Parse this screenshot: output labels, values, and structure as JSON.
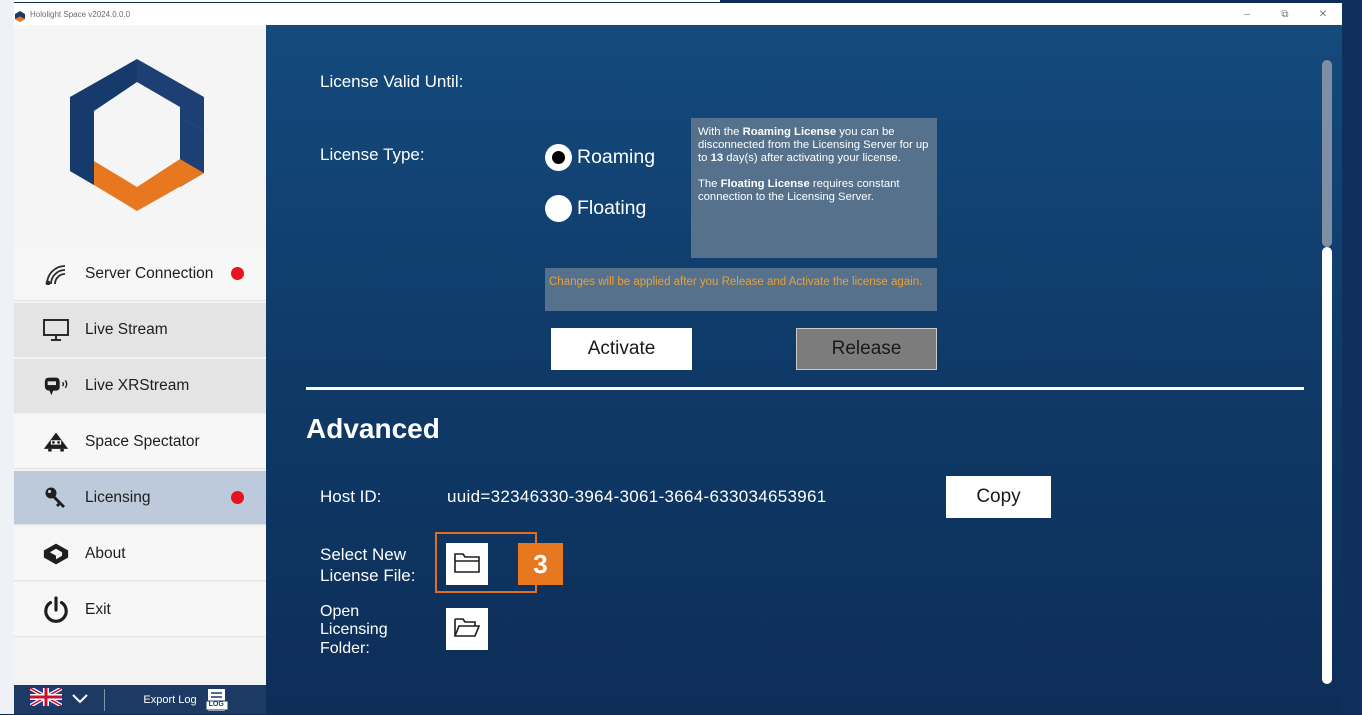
{
  "window": {
    "title": "Hololight Space v2024.0.0.0",
    "minimize": "–",
    "maximize": "⧉",
    "close": "✕"
  },
  "sidebar": {
    "items": [
      {
        "label": "Server Connection",
        "icon": "wifi-icon",
        "status_dot": true
      },
      {
        "label": "Live Stream",
        "icon": "monitor-icon",
        "status_dot": false
      },
      {
        "label": "Live XRStream",
        "icon": "xr-headset-icon",
        "status_dot": false
      },
      {
        "label": "Space Spectator",
        "icon": "spectator-icon",
        "status_dot": false
      },
      {
        "label": "Licensing",
        "icon": "key-icon",
        "status_dot": true,
        "selected": true
      },
      {
        "label": "About",
        "icon": "about-icon",
        "status_dot": false
      },
      {
        "label": "Exit",
        "icon": "power-icon",
        "status_dot": false
      }
    ],
    "bottom": {
      "language_icon": "uk-flag-icon",
      "export_label": "Export Log",
      "export_icon_text": "LOG"
    }
  },
  "license": {
    "valid_until_label": "License Valid Until:",
    "type_label": "License Type:",
    "options": [
      {
        "label": "Roaming",
        "selected": true
      },
      {
        "label": "Floating",
        "selected": false
      }
    ],
    "info": {
      "roaming_prefix": "With the ",
      "roaming_bold": "Roaming License",
      "roaming_mid": " you can be disconnected from the Licensing Server for up to ",
      "roaming_days": "13",
      "roaming_suffix": " day(s) after activating your license.",
      "floating_prefix": "The ",
      "floating_bold": "Floating License",
      "floating_suffix": " requires constant connection to the Licensing Server."
    },
    "warning": "Changes will be applied after you Release and Activate the license again.",
    "activate_label": "Activate",
    "release_label": "Release"
  },
  "advanced": {
    "title": "Advanced",
    "host_id_label": "Host ID:",
    "host_id_value": "uuid=32346330-3964-3061-3664-633034653961",
    "copy_label": "Copy",
    "select_file_label_line1": "Select New",
    "select_file_label_line2": "License File:",
    "open_folder_line1": "Open",
    "open_folder_line2": "Licensing",
    "open_folder_line3": "Folder:",
    "step_number": "3"
  },
  "colors": {
    "accent_orange": "#e8781f",
    "status_red": "#e8141b",
    "main_bg": "#144a7d",
    "selected_nav": "#bccadb"
  }
}
